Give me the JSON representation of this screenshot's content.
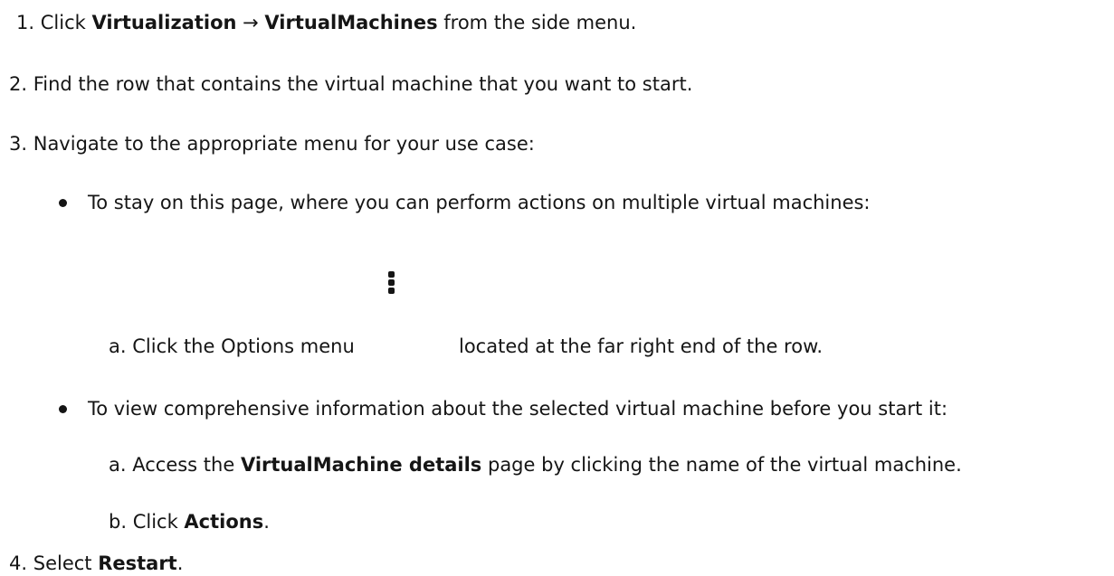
{
  "steps": [
    {
      "num": "1.",
      "pre": "Click ",
      "b1": "Virtualization",
      "arrow": " → ",
      "b2": "VirtualMachines",
      "post": " from the side menu."
    },
    {
      "num": "2.",
      "text": "Find the row that contains the virtual machine that you want to start."
    },
    {
      "num": "3.",
      "text": "Navigate to the appropriate menu for your use case:"
    },
    {
      "num": "4.",
      "pre": "Select ",
      "b1": "Restart",
      "post": "."
    }
  ],
  "bullets": [
    {
      "text": "To stay on this page, where you can perform actions on multiple virtual machines:",
      "sub": [
        {
          "letter": "a.",
          "pre": "Click the Options menu",
          "icon": "kebab-options-icon",
          "post": "located at the far right end of the row."
        }
      ]
    },
    {
      "text": "To view comprehensive information about the selected virtual machine before you start it:",
      "sub": [
        {
          "letter": "a.",
          "pre": "Access the ",
          "b1": "VirtualMachine details",
          "post": " page by clicking the name of the virtual machine."
        },
        {
          "letter": "b.",
          "pre": "Click ",
          "b1": "Actions",
          "post": "."
        }
      ]
    }
  ]
}
